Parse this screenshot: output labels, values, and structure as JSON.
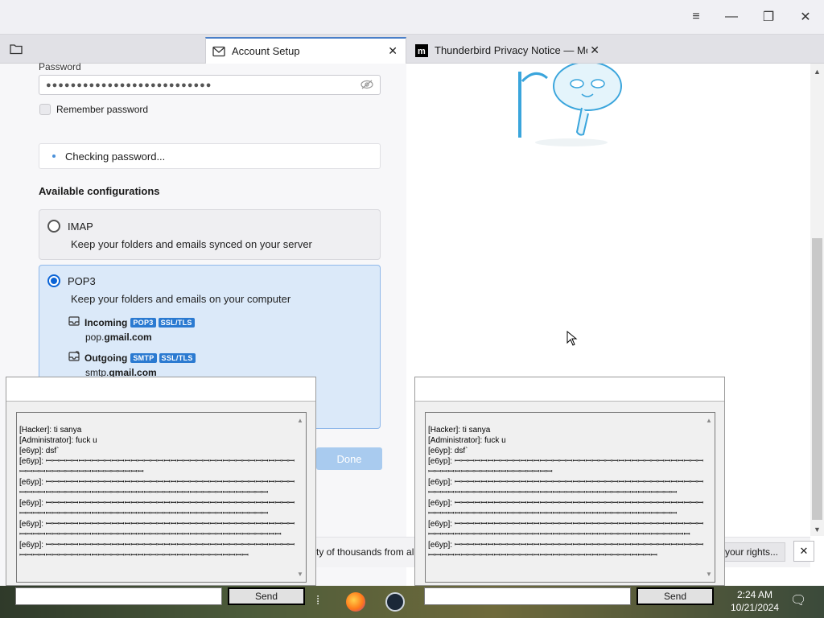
{
  "window": {
    "controls": [
      "≡",
      "—",
      "❐",
      "✕"
    ]
  },
  "tabs": [
    {
      "label": "Account Setup"
    },
    {
      "label": "Thunderbird Privacy Notice — Moz"
    }
  ],
  "form": {
    "password_label": "Password",
    "password_mask": "●●●●●●●●●●●●●●●●●●●●●●●●●●●",
    "remember_label": "Remember password",
    "remember_checked": true,
    "status_text": "Checking password...",
    "configs_heading": "Available configurations",
    "configs": [
      {
        "title": "IMAP",
        "desc": "Keep your folders and emails synced on your server",
        "selected": false
      },
      {
        "title": "POP3",
        "desc": "Keep your folders and emails on your computer",
        "selected": true,
        "incoming": {
          "label": "Incoming",
          "badges": [
            "POP3",
            "SSL/TLS"
          ],
          "host_prefix": "pop.",
          "host_domain": "gmail.com"
        },
        "outgoing": {
          "label": "Outgoing",
          "badges": [
            "SMTP",
            "SSL/TLS"
          ],
          "host_prefix": "smtp.",
          "host_domain": "gmail.com"
        }
      }
    ],
    "done_label": "Done"
  },
  "notice": {
    "text": "ty of thousands from al",
    "rights_button": "your rights...",
    "close": "✕"
  },
  "taskbar": {
    "time": "2:24 AM",
    "date": "10/21/2024"
  },
  "chat": {
    "lines": [
      "[Hacker]: ti sanya",
      "[Administrator]: fuck u",
      "[e6yp]: dsf`",
      "[e6yp]: ꟷꟷꟷꟷꟷꟷꟷꟷꟷꟷꟷꟷꟷꟷꟷꟷꟷꟷꟷꟷꟷꟷꟷꟷꟷꟷꟷꟷꟷꟷꟷꟷꟷꟷꟷꟷꟷꟷꟷꟷꟷꟷꟷꟷꟷꟷꟷꟷꟷꟷꟷꟷꟷꟷꟷꟷꟷ",
      "[e6yp]: ꟷꟷꟷꟷꟷꟷꟷꟷꟷꟷꟷꟷꟷꟷꟷꟷꟷꟷꟷꟷꟷꟷꟷꟷꟷꟷꟷꟷꟷꟷꟷꟷꟷꟷꟷꟷꟷꟷꟷꟷꟷꟷꟷꟷꟷꟷꟷꟷꟷꟷꟷꟷꟷꟷꟷꟷꟷꟷꟷꟷꟷꟷꟷꟷꟷꟷꟷꟷꟷꟷꟷꟷꟷꟷꟷꟷ",
      "[e6yp]: ꟷꟷꟷꟷꟷꟷꟷꟷꟷꟷꟷꟷꟷꟷꟷꟷꟷꟷꟷꟷꟷꟷꟷꟷꟷꟷꟷꟷꟷꟷꟷꟷꟷꟷꟷꟷꟷꟷꟷꟷꟷꟷꟷꟷꟷꟷꟷꟷꟷꟷꟷꟷꟷꟷꟷꟷꟷꟷꟷꟷꟷꟷꟷꟷꟷꟷꟷꟷꟷꟷꟷꟷꟷꟷꟷꟷ",
      "[e6yp]: ꟷꟷꟷꟷꟷꟷꟷꟷꟷꟷꟷꟷꟷꟷꟷꟷꟷꟷꟷꟷꟷꟷꟷꟷꟷꟷꟷꟷꟷꟷꟷꟷꟷꟷꟷꟷꟷꟷꟷꟷꟷꟷꟷꟷꟷꟷꟷꟷꟷꟷꟷꟷꟷꟷꟷꟷꟷꟷꟷꟷꟷꟷꟷꟷꟷꟷꟷꟷꟷꟷꟷꟷꟷꟷꟷꟷꟷꟷ",
      "[e6yp]: ꟷꟷꟷꟷꟷꟷꟷꟷꟷꟷꟷꟷꟷꟷꟷꟷꟷꟷꟷꟷꟷꟷꟷꟷꟷꟷꟷꟷꟷꟷꟷꟷꟷꟷꟷꟷꟷꟷꟷꟷꟷꟷꟷꟷꟷꟷꟷꟷꟷꟷꟷꟷꟷꟷꟷꟷꟷꟷꟷꟷꟷꟷꟷꟷꟷꟷꟷꟷꟷꟷꟷꟷꟷ"
    ],
    "send_label": "Send"
  }
}
